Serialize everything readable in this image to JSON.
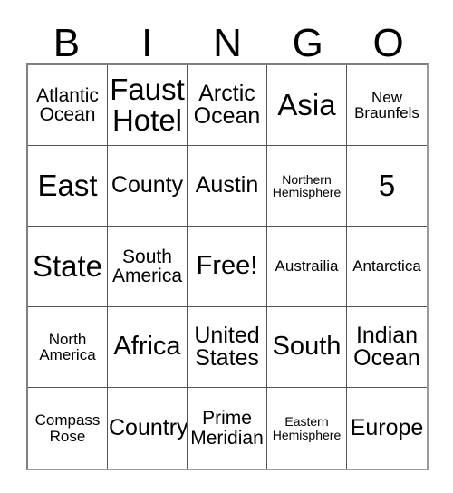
{
  "card": {
    "title": "BINGO",
    "header_letters": [
      "B",
      "I",
      "N",
      "G",
      "O"
    ],
    "free_space_label": "Free!",
    "colors": {
      "background": "#ffffff",
      "text": "#000000",
      "grid_line": "#555555",
      "outer_border": "#808080"
    },
    "rows": [
      [
        {
          "text": "Atlantic\nOcean",
          "size": "sm"
        },
        {
          "text": "Faust\nHotel",
          "size": "xl"
        },
        {
          "text": "Arctic\nOcean",
          "size": "md"
        },
        {
          "text": "Asia",
          "size": "xl"
        },
        {
          "text": "New\nBraunfels",
          "size": "xs"
        }
      ],
      [
        {
          "text": "East",
          "size": "xl"
        },
        {
          "text": "County",
          "size": "md"
        },
        {
          "text": "Austin",
          "size": "md"
        },
        {
          "text": "Northern\nHemisphere",
          "size": "xxs"
        },
        {
          "text": "5",
          "size": "xl"
        }
      ],
      [
        {
          "text": "State",
          "size": "xl"
        },
        {
          "text": "South\nAmerica",
          "size": "sm"
        },
        {
          "text": "Free!",
          "size": "lg"
        },
        {
          "text": "Austrailia",
          "size": "xs"
        },
        {
          "text": "Antarctica",
          "size": "xs"
        }
      ],
      [
        {
          "text": "North\nAmerica",
          "size": "xs"
        },
        {
          "text": "Africa",
          "size": "lg"
        },
        {
          "text": "United\nStates",
          "size": "md"
        },
        {
          "text": "South",
          "size": "lg"
        },
        {
          "text": "Indian\nOcean",
          "size": "md"
        }
      ],
      [
        {
          "text": "Compass\nRose",
          "size": "xs"
        },
        {
          "text": "Country",
          "size": "md"
        },
        {
          "text": "Prime\nMeridian",
          "size": "sm"
        },
        {
          "text": "Eastern\nHemisphere",
          "size": "xxs"
        },
        {
          "text": "Europe",
          "size": "md"
        }
      ]
    ]
  }
}
